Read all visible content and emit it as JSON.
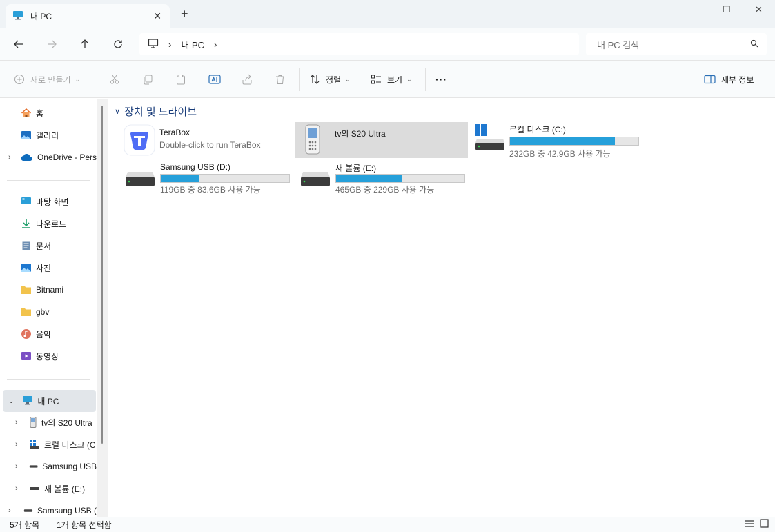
{
  "colors": {
    "accent": "#26a0da",
    "folder": "#f2c34c",
    "nav_blue": "#1a3d7a"
  },
  "window": {
    "tab_title": "내 PC",
    "close_tab_glyph": "✕",
    "new_tab_glyph": "+",
    "minimize_glyph": "—",
    "maximize_glyph": "☐",
    "close_glyph": "✕"
  },
  "navbar": {
    "breadcrumb": [
      "내 PC"
    ],
    "search_placeholder": "내 PC 검색"
  },
  "toolbar": {
    "new_label": "새로 만들기",
    "sort_label": "정렬",
    "view_label": "보기",
    "more_label": "···",
    "details_label": "세부 정보"
  },
  "sidebar": {
    "home": "홈",
    "gallery": "갤러리",
    "onedrive": "OneDrive - Pers",
    "pinned": [
      {
        "label": "바탕 화면",
        "icon": "desktop-icon"
      },
      {
        "label": "다운로드",
        "icon": "download-icon"
      },
      {
        "label": "문서",
        "icon": "document-icon"
      },
      {
        "label": "사진",
        "icon": "pictures-icon"
      },
      {
        "label": "Bitnami",
        "icon": "folder-icon"
      },
      {
        "label": "gbv",
        "icon": "folder-icon"
      },
      {
        "label": "음악",
        "icon": "music-icon"
      },
      {
        "label": "동영상",
        "icon": "video-icon"
      }
    ],
    "this_pc": "내 PC",
    "this_pc_children": [
      {
        "label": "tv의 S20 Ultra",
        "icon": "phone-icon"
      },
      {
        "label": "로컬 디스크 (C",
        "icon": "windows-drive-icon"
      },
      {
        "label": "Samsung USB",
        "icon": "drive-icon"
      },
      {
        "label": "새 볼륨 (E:)",
        "icon": "drive-icon"
      }
    ],
    "last_item": "Samsung USB ("
  },
  "main": {
    "group_title": "장치 및 드라이브",
    "terabox": {
      "name": "TeraBox",
      "sub": "Double-click to run TeraBox"
    },
    "phone": {
      "name": "tv의 S20 Ultra"
    },
    "drive_c": {
      "name": "로컬 디스크 (C:)",
      "free": "232GB 중 42.9GB 사용 가능",
      "used_fraction": 0.815
    },
    "drive_d": {
      "name": "Samsung USB (D:)",
      "free": "119GB 중 83.6GB 사용 가능",
      "used_fraction": 0.3
    },
    "drive_e": {
      "name": "새 볼륨 (E:)",
      "free": "465GB 중 229GB 사용 가능",
      "used_fraction": 0.51
    }
  },
  "status": {
    "item_count": "5개 항목",
    "selection": "1개 항목 선택함"
  }
}
